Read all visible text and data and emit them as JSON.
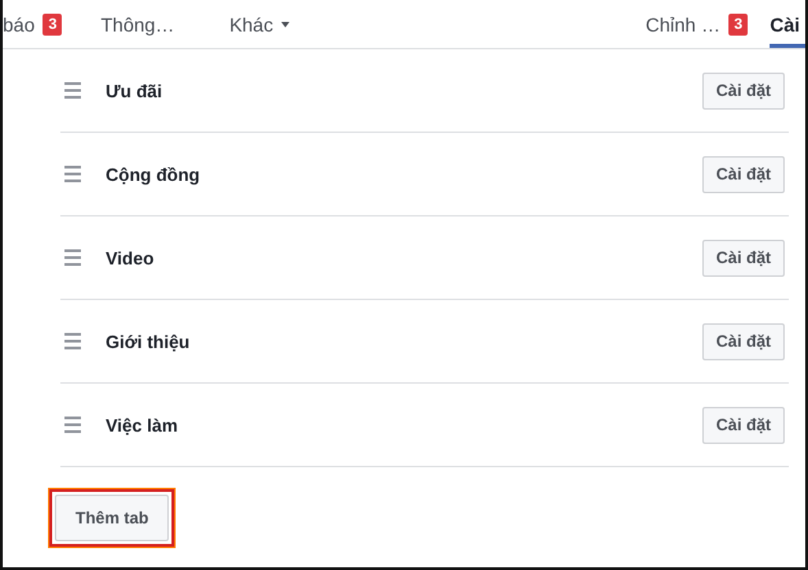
{
  "tabs": [
    {
      "label": "báo",
      "badge": "3",
      "selected": false
    },
    {
      "label": "Thông…",
      "selected": false
    },
    {
      "label": "Khác",
      "dropdown": true,
      "selected": false
    },
    {
      "label": "Chỉnh …",
      "badge": "3",
      "selected": false
    },
    {
      "label": "Cài",
      "selected": true
    }
  ],
  "rows": [
    {
      "label": "Ưu đãi",
      "button": "Cài đặt"
    },
    {
      "label": "Cộng đồng",
      "button": "Cài đặt"
    },
    {
      "label": "Video",
      "button": "Cài đặt"
    },
    {
      "label": "Giới thiệu",
      "button": "Cài đặt"
    },
    {
      "label": "Việc làm",
      "button": "Cài đặt"
    }
  ],
  "add_button": {
    "label": "Thêm tab",
    "highlighted": true
  }
}
